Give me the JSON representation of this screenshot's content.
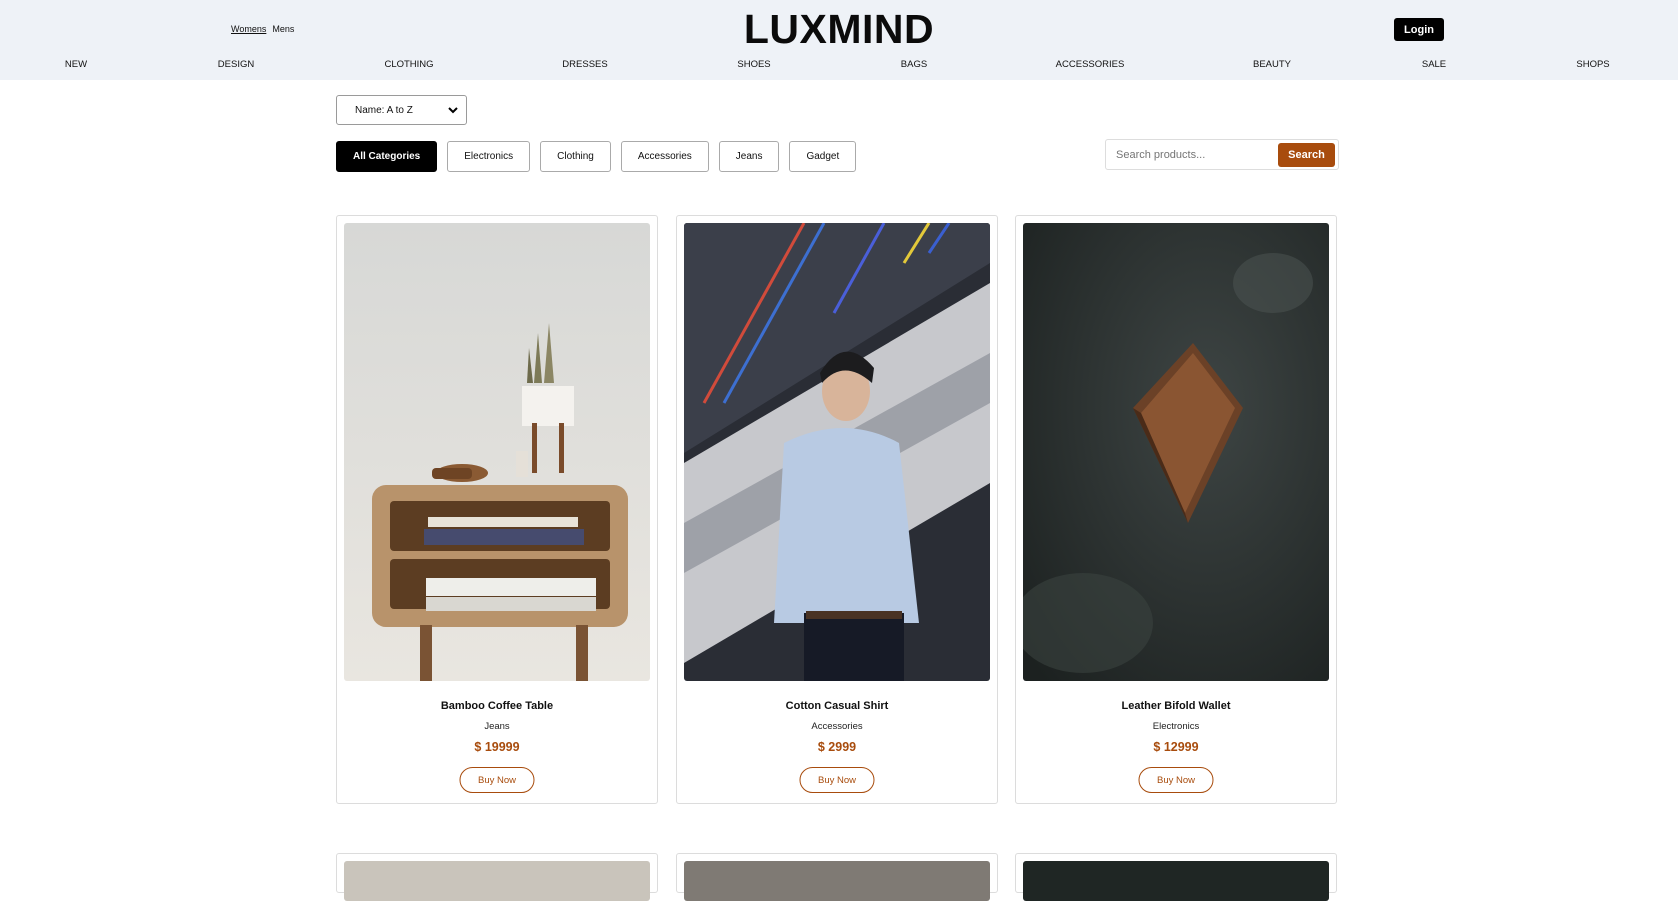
{
  "header": {
    "gender_tabs": [
      {
        "label": "Womens"
      },
      {
        "label": "Mens"
      }
    ],
    "logo": "LUXMIND",
    "login_label": "Login"
  },
  "nav": [
    "NEW",
    "DESIGN",
    "CLOTHING",
    "DRESSES",
    "SHOES",
    "BAGS",
    "ACCESSORIES",
    "BEAUTY",
    "SALE",
    "SHOPS"
  ],
  "sort": {
    "selected": "Name: A to Z"
  },
  "categories": [
    {
      "label": "All Categories",
      "active": true
    },
    {
      "label": "Electronics"
    },
    {
      "label": "Clothing"
    },
    {
      "label": "Accessories"
    },
    {
      "label": "Jeans"
    },
    {
      "label": "Gadget"
    }
  ],
  "search": {
    "placeholder": "Search products...",
    "button_label": "Search"
  },
  "products": [
    {
      "name": "Bamboo Coffee Table",
      "category": "Jeans",
      "price": "$ 19999",
      "buy_label": "Buy Now"
    },
    {
      "name": "Cotton Casual Shirt",
      "category": "Accessories",
      "price": "$ 2999",
      "buy_label": "Buy Now"
    },
    {
      "name": "Leather Bifold Wallet",
      "category": "Electronics",
      "price": "$ 12999",
      "buy_label": "Buy Now"
    }
  ],
  "colors": {
    "accent": "#a84c0d",
    "header_bg": "#eef2f7",
    "primary_button": "#000000"
  }
}
